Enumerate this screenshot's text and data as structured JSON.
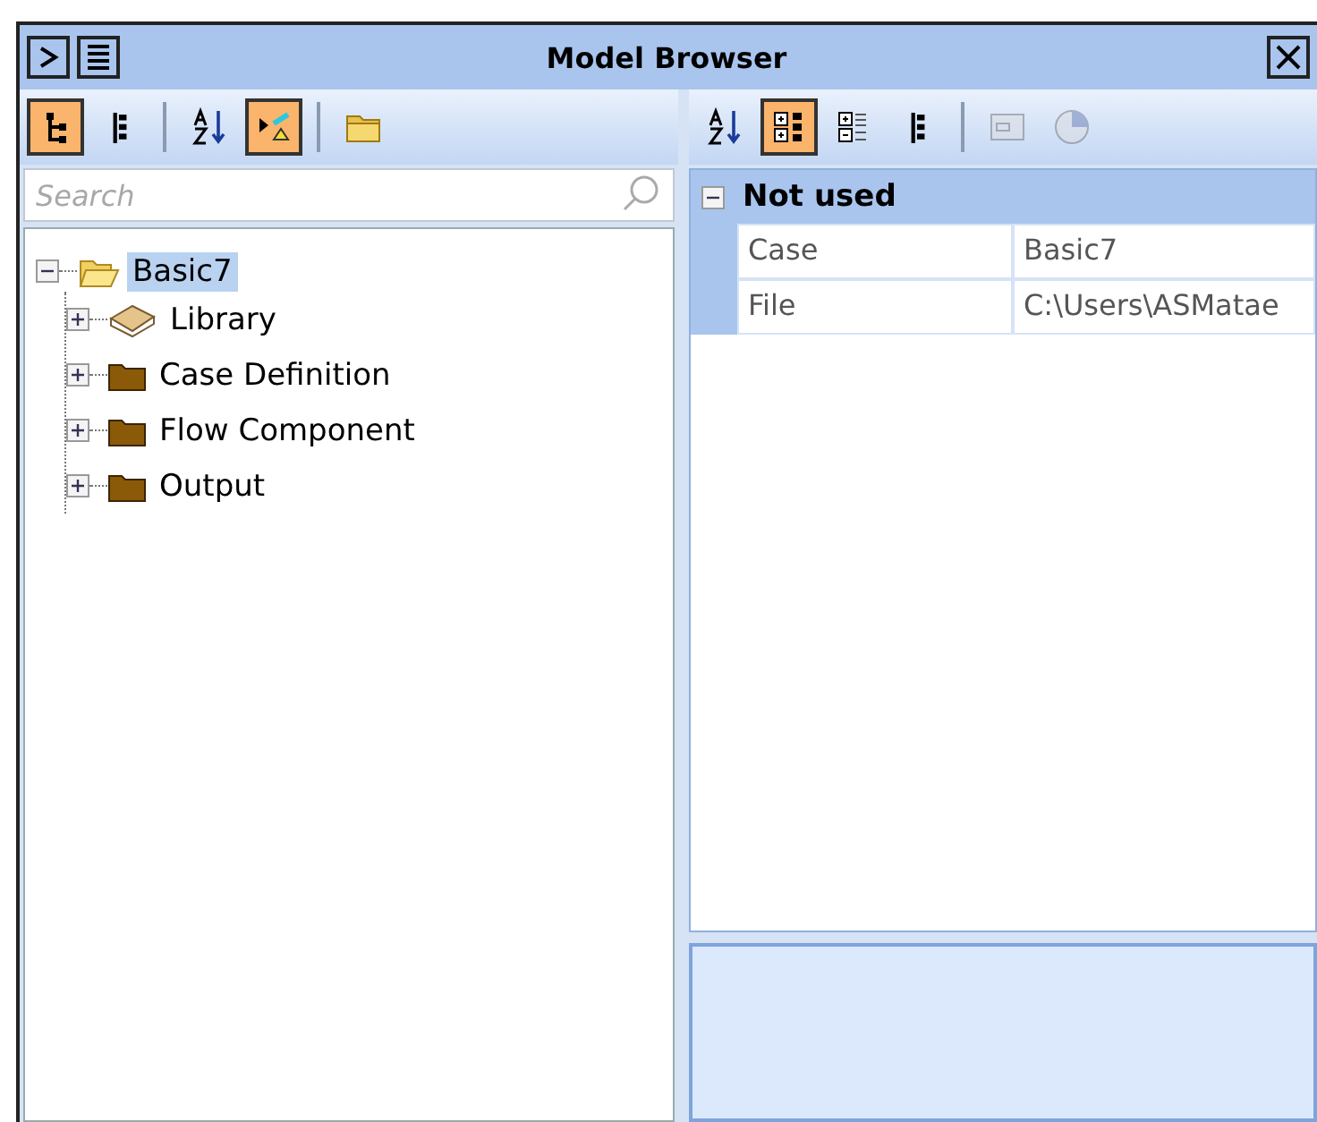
{
  "window": {
    "title": "Model Browser"
  },
  "left_toolbar": [
    {
      "kind": "tree",
      "selected": true
    },
    {
      "kind": "flat",
      "selected": false
    },
    {
      "kind": "separator"
    },
    {
      "kind": "sort",
      "selected": false
    },
    {
      "kind": "filter",
      "selected": true
    },
    {
      "kind": "separator"
    },
    {
      "kind": "folder",
      "selected": false
    }
  ],
  "right_toolbar": [
    {
      "kind": "sort",
      "selected": false
    },
    {
      "kind": "categorized",
      "selected": true
    },
    {
      "kind": "expand",
      "selected": false
    },
    {
      "kind": "flat",
      "selected": false
    },
    {
      "kind": "separator"
    },
    {
      "kind": "window",
      "disabled": true
    },
    {
      "kind": "pie",
      "disabled": true
    }
  ],
  "search": {
    "placeholder": "Search"
  },
  "tree": [
    {
      "label": "Basic7",
      "kind": "case",
      "expanded": true,
      "selected": true,
      "children": [
        {
          "label": "Library",
          "kind": "library",
          "expanded": false,
          "selected": false
        },
        {
          "label": "Case Definition",
          "kind": "group",
          "expanded": false,
          "selected": false
        },
        {
          "label": "Flow Component",
          "kind": "group",
          "expanded": false,
          "selected": false
        },
        {
          "label": "Output",
          "kind": "group",
          "expanded": false,
          "selected": false
        }
      ]
    }
  ],
  "properties": [
    {
      "category": "Not used",
      "expanded": true,
      "rows": [
        {
          "name": "Case",
          "value": "Basic7"
        },
        {
          "name": "File",
          "value": "C:\\Users\\ASMatae"
        }
      ]
    }
  ]
}
